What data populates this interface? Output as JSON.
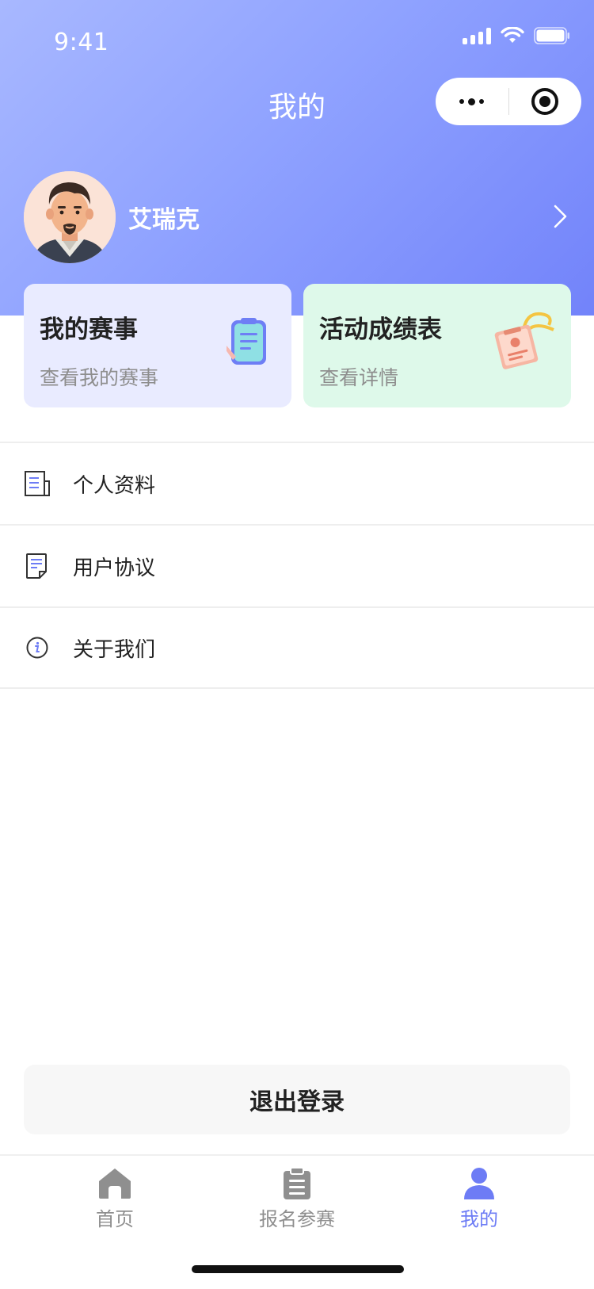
{
  "status_bar": {
    "time": "9:41"
  },
  "header": {
    "title": "我的"
  },
  "capsule": {
    "more_icon": "more-dots-icon",
    "close_icon": "target-icon"
  },
  "profile": {
    "username": "艾瑞克",
    "arrow_icon": "chevron-right-icon"
  },
  "cards": [
    {
      "title": "我的赛事",
      "subtitle": "查看我的赛事",
      "bg": "#e9ebff"
    },
    {
      "title": "活动成绩表",
      "subtitle": "查看详情",
      "bg": "#def9ea"
    }
  ],
  "menu": [
    {
      "label": "个人资料",
      "icon": "document-icon"
    },
    {
      "label": "用户协议",
      "icon": "agreement-icon"
    },
    {
      "label": "关于我们",
      "icon": "info-icon"
    }
  ],
  "logout": {
    "label": "退出登录"
  },
  "tabbar": [
    {
      "label": "首页",
      "icon": "home-icon",
      "active": false
    },
    {
      "label": "报名参赛",
      "icon": "clipboard-icon",
      "active": false
    },
    {
      "label": "我的",
      "icon": "user-icon",
      "active": true
    }
  ],
  "colors": {
    "accent": "#6d7cf5",
    "header_start": "#a8b8ff",
    "header_end": "#7283fa",
    "inactive": "#8f8f8f"
  }
}
